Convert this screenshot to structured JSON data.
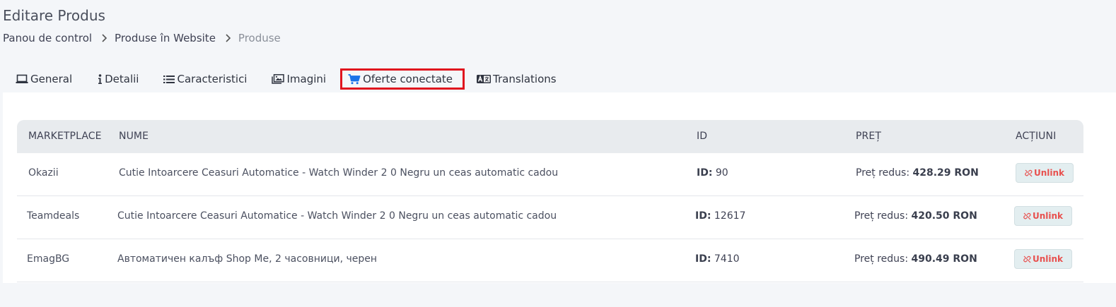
{
  "page": {
    "title": "Editare Produs",
    "breadcrumb": [
      "Panou de control",
      "Produse în Website",
      "Produse"
    ]
  },
  "tabs": [
    {
      "label": "General",
      "icon": "laptop-icon"
    },
    {
      "label": "Detalii",
      "icon": "info-icon"
    },
    {
      "label": "Caracteristici",
      "icon": "list-icon"
    },
    {
      "label": "Imagini",
      "icon": "images-icon"
    },
    {
      "label": "Oferte conectate",
      "icon": "cart-icon",
      "active": true
    },
    {
      "label": "Translations",
      "icon": "language-icon"
    }
  ],
  "table": {
    "columns": [
      "MARKETPLACE",
      "NUME",
      "ID",
      "PREȚ",
      "ACȚIUNI"
    ],
    "id_prefix": "ID:",
    "price_prefix": "Preț redus:",
    "unlink_label": "Unlink",
    "rows": [
      {
        "marketplace": "Okazii",
        "name": "Cutie Intoarcere Ceasuri Automatice - Watch Winder 2 0 Negru un ceas automatic cadou",
        "id": "90",
        "price": "428.29 RON"
      },
      {
        "marketplace": "Teamdeals",
        "name": "Cutie Intoarcere Ceasuri Automatice - Watch Winder 2 0 Negru un ceas automatic cadou",
        "id": "12617",
        "price": "420.50 RON"
      },
      {
        "marketplace": "EmagBG",
        "name": "Автоматичен калъф Shop Me, 2 часовници, черен",
        "id": "7410",
        "price": "490.49 RON"
      }
    ]
  },
  "colors": {
    "active_tab_border": "#e0141e",
    "cart_icon": "#1a73e8",
    "unlink_text": "#e8504e"
  }
}
